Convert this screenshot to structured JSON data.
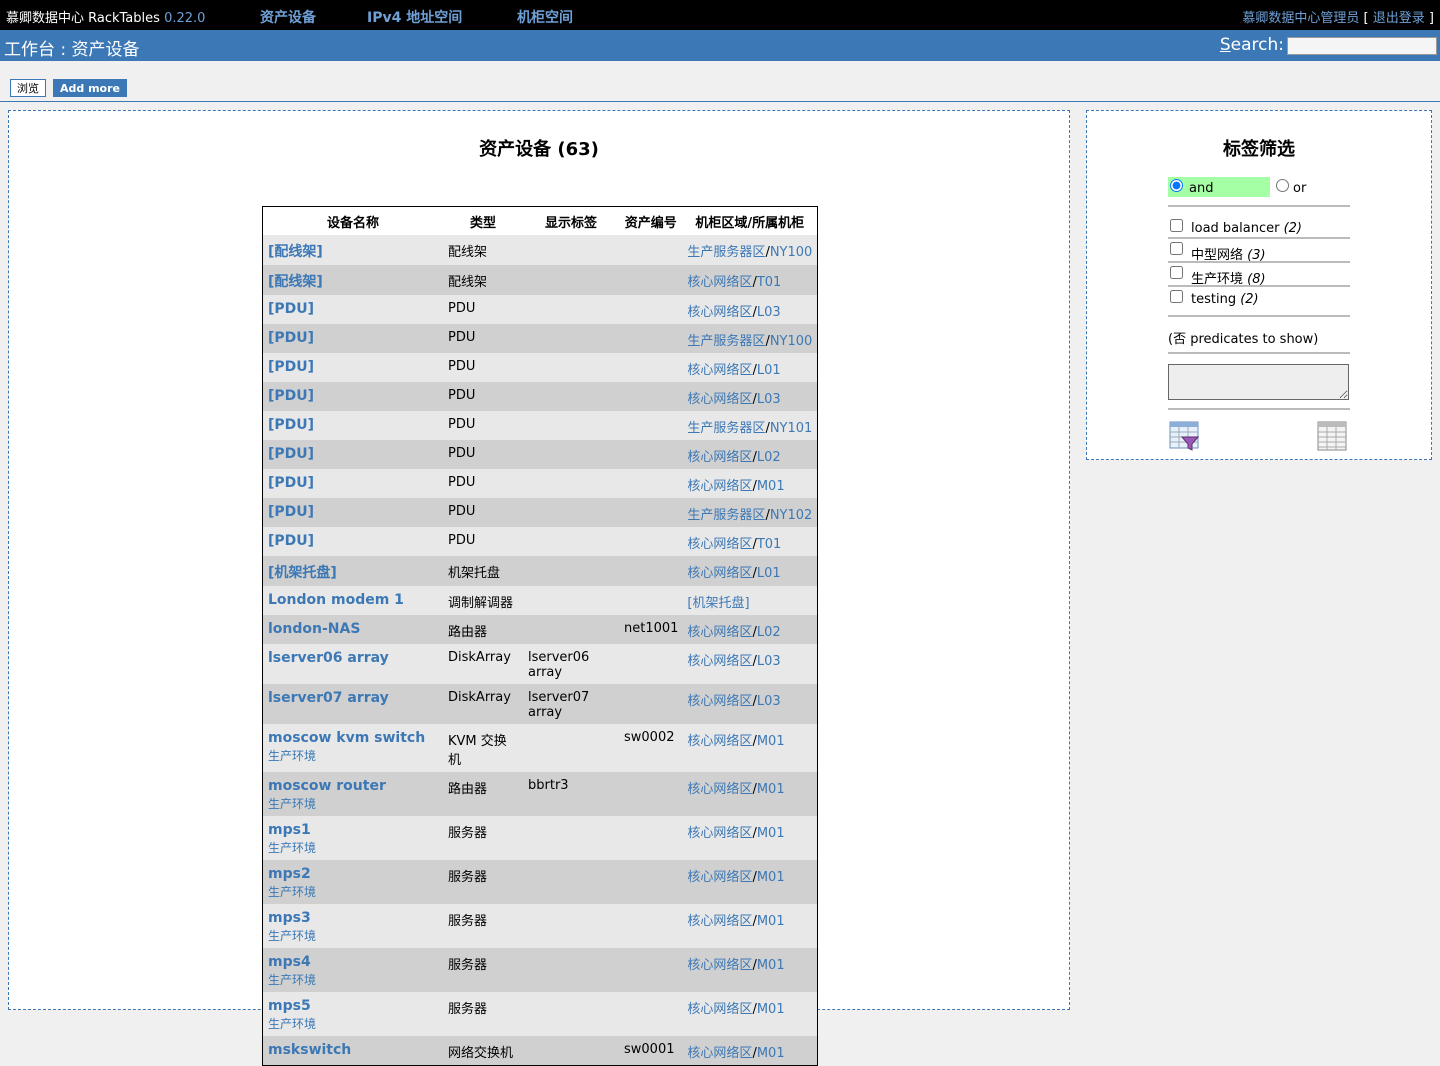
{
  "topbar": {
    "brand": "慕卿数据中心 RackTables",
    "version": "0.22.0",
    "menu": [
      "资产设备",
      "IPv4 地址空间",
      "机柜空间"
    ],
    "user": "慕卿数据中心管理员",
    "logout": "退出登录",
    "bracket_open": "[",
    "bracket_close": "]"
  },
  "titlebar": {
    "title": "工作台 : 资产设备",
    "search_label_first": "S",
    "search_label_rest": "earch:"
  },
  "tabs": {
    "browse": "浏览",
    "add_more": "Add more"
  },
  "main": {
    "heading": "资产设备 (63)",
    "columns": [
      "设备名称",
      "类型",
      "显示标签",
      "资产编号",
      "机柜区域/所属机柜"
    ],
    "rows": [
      {
        "name": "[配线架]",
        "tag": "",
        "type": "配线架",
        "label": "",
        "asset": "",
        "zone": "生产服务器区",
        "rack": "NY100"
      },
      {
        "name": "[配线架]",
        "tag": "",
        "type": "配线架",
        "label": "",
        "asset": "",
        "zone": "核心网络区",
        "rack": "T01"
      },
      {
        "name": "[PDU]",
        "tag": "",
        "type": "PDU",
        "label": "",
        "asset": "",
        "zone": "核心网络区",
        "rack": "L03"
      },
      {
        "name": "[PDU]",
        "tag": "",
        "type": "PDU",
        "label": "",
        "asset": "",
        "zone": "生产服务器区",
        "rack": "NY100"
      },
      {
        "name": "[PDU]",
        "tag": "",
        "type": "PDU",
        "label": "",
        "asset": "",
        "zone": "核心网络区",
        "rack": "L01"
      },
      {
        "name": "[PDU]",
        "tag": "",
        "type": "PDU",
        "label": "",
        "asset": "",
        "zone": "核心网络区",
        "rack": "L03"
      },
      {
        "name": "[PDU]",
        "tag": "",
        "type": "PDU",
        "label": "",
        "asset": "",
        "zone": "生产服务器区",
        "rack": "NY101"
      },
      {
        "name": "[PDU]",
        "tag": "",
        "type": "PDU",
        "label": "",
        "asset": "",
        "zone": "核心网络区",
        "rack": "L02"
      },
      {
        "name": "[PDU]",
        "tag": "",
        "type": "PDU",
        "label": "",
        "asset": "",
        "zone": "核心网络区",
        "rack": "M01"
      },
      {
        "name": "[PDU]",
        "tag": "",
        "type": "PDU",
        "label": "",
        "asset": "",
        "zone": "生产服务器区",
        "rack": "NY102"
      },
      {
        "name": "[PDU]",
        "tag": "",
        "type": "PDU",
        "label": "",
        "asset": "",
        "zone": "核心网络区",
        "rack": "T01"
      },
      {
        "name": "[机架托盘]",
        "tag": "",
        "type": "机架托盘",
        "label": "",
        "asset": "",
        "zone": "核心网络区",
        "rack": "L01"
      },
      {
        "name": "London modem 1",
        "tag": "",
        "type": "调制解调器",
        "label": "",
        "asset": "",
        "zone": "[机架托盘]",
        "rack": ""
      },
      {
        "name": "london-NAS",
        "tag": "",
        "type": "路由器",
        "label": "",
        "asset": "net1001",
        "zone": "核心网络区",
        "rack": "L02"
      },
      {
        "name": "lserver06 array",
        "tag": "",
        "type": "DiskArray",
        "label": "lserver06 array",
        "asset": "",
        "zone": "核心网络区",
        "rack": "L03"
      },
      {
        "name": "lserver07 array",
        "tag": "",
        "type": "DiskArray",
        "label": "lserver07 array",
        "asset": "",
        "zone": "核心网络区",
        "rack": "L03"
      },
      {
        "name": "moscow kvm switch",
        "tag": "生产环境",
        "type": "KVM 交换机",
        "label": "",
        "asset": "sw0002",
        "zone": "核心网络区",
        "rack": "M01"
      },
      {
        "name": "moscow router",
        "tag": "生产环境",
        "type": "路由器",
        "label": "bbrtr3",
        "asset": "",
        "zone": "核心网络区",
        "rack": "M01"
      },
      {
        "name": "mps1",
        "tag": "生产环境",
        "type": "服务器",
        "label": "",
        "asset": "",
        "zone": "核心网络区",
        "rack": "M01"
      },
      {
        "name": "mps2",
        "tag": "生产环境",
        "type": "服务器",
        "label": "",
        "asset": "",
        "zone": "核心网络区",
        "rack": "M01"
      },
      {
        "name": "mps3",
        "tag": "生产环境",
        "type": "服务器",
        "label": "",
        "asset": "",
        "zone": "核心网络区",
        "rack": "M01"
      },
      {
        "name": "mps4",
        "tag": "生产环境",
        "type": "服务器",
        "label": "",
        "asset": "",
        "zone": "核心网络区",
        "rack": "M01"
      },
      {
        "name": "mps5",
        "tag": "生产环境",
        "type": "服务器",
        "label": "",
        "asset": "",
        "zone": "核心网络区",
        "rack": "M01"
      },
      {
        "name": "mskswitch",
        "tag": "",
        "type": "网络交换机",
        "label": "",
        "asset": "sw0001",
        "zone": "核心网络区",
        "rack": "M01"
      }
    ]
  },
  "side": {
    "heading": "标签筛选",
    "and_label": "and",
    "or_label": "or",
    "tags": [
      {
        "name": "load balancer",
        "count": "(2)"
      },
      {
        "name": "中型网络",
        "count": "(3)"
      },
      {
        "name": "生产环境",
        "count": "(8)"
      },
      {
        "name": "testing",
        "count": "(2)"
      }
    ],
    "no_predicates": "(否 predicates to show)"
  },
  "colors": {
    "accent": "#3c78b5",
    "topbar": "#000000",
    "and_highlight": "#a5ffa5"
  }
}
